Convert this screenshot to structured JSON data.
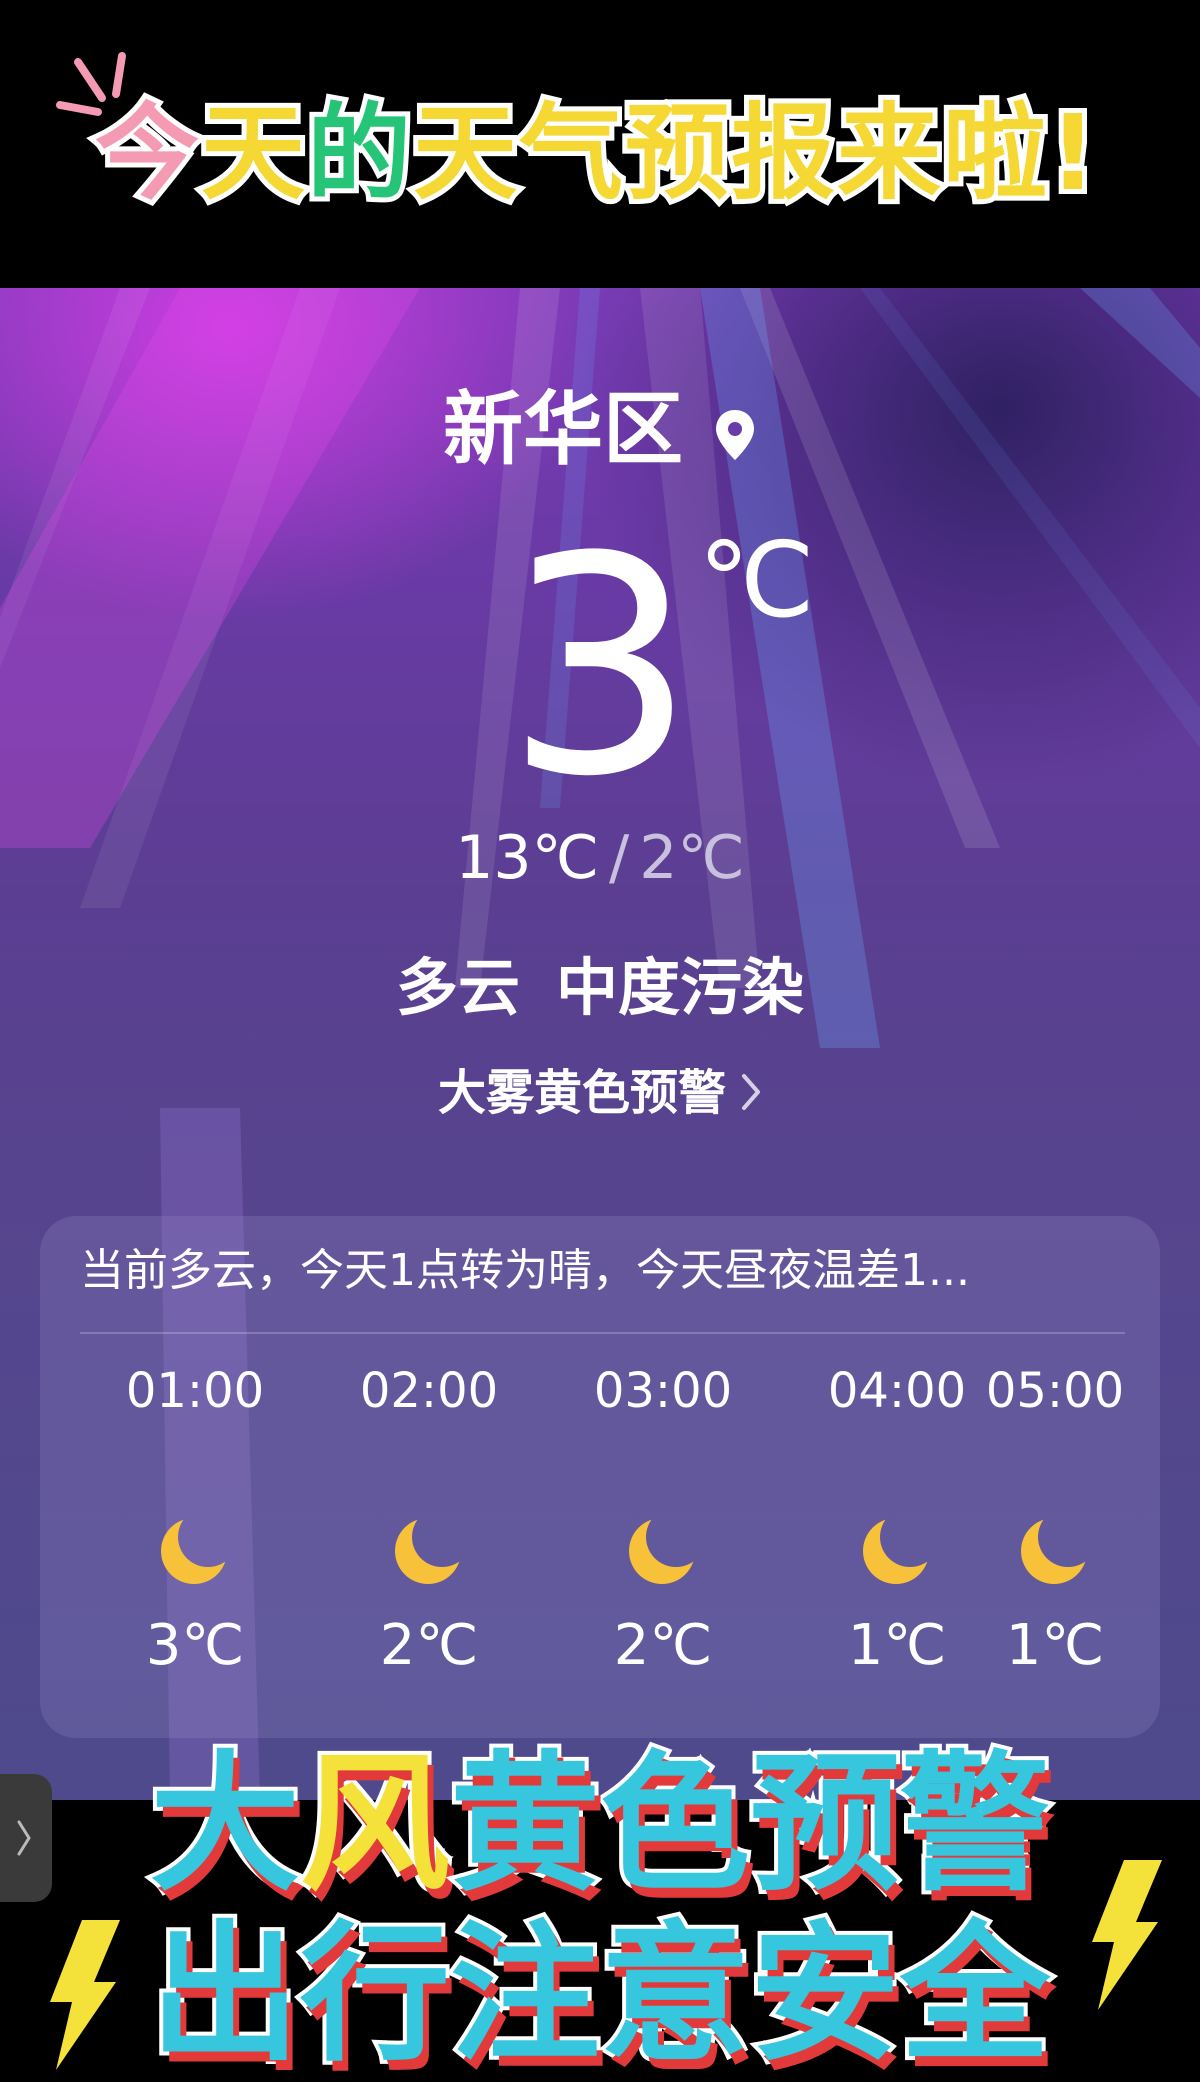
{
  "banner": {
    "headline_parts": [
      "今",
      "天",
      "的",
      "天气预报来啦",
      "!"
    ],
    "slogan_line1_a": "大",
    "slogan_line1_b": "风",
    "slogan_line1_c": "黄色预警",
    "slogan_line2": "出行注意安全"
  },
  "weather": {
    "location": "新华区",
    "location_icon": "map-pin-icon",
    "current_temp": "3",
    "unit": "℃",
    "high": "13℃",
    "separator": "/",
    "low": "2℃",
    "condition": "多云",
    "air_quality": "中度污染",
    "alert": "大雾黄色预警",
    "alert_icon": "chevron-right-icon"
  },
  "forecast": {
    "summary": "当前多云，今天1点转为晴，今天昼夜温差1...",
    "hours": [
      {
        "time": "01:00",
        "icon": "moon-icon",
        "temp": "3℃"
      },
      {
        "time": "02:00",
        "icon": "moon-icon",
        "temp": "2℃"
      },
      {
        "time": "03:00",
        "icon": "moon-icon",
        "temp": "2℃"
      },
      {
        "time": "04:00",
        "icon": "moon-icon",
        "temp": "1℃"
      },
      {
        "time": "05:00",
        "icon": "moon-icon",
        "temp": "1℃"
      }
    ]
  },
  "colors": {
    "moon": "#f7c23a",
    "accent_cyan": "#36c6de",
    "accent_yellow": "#f4e23a",
    "shadow_red": "#e23a3a"
  }
}
